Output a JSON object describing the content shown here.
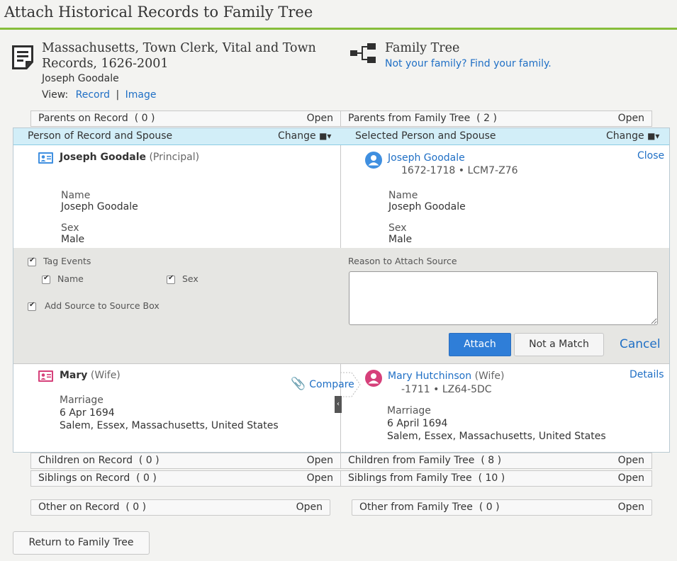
{
  "page": {
    "title": "Attach Historical Records to Family Tree"
  },
  "record": {
    "collection_title_line1": "Massachusetts, Town Clerk, Vital and Town",
    "collection_title_line2": "Records, 1626-2001",
    "person": "Joseph Goodale",
    "view_label": "View:",
    "view_record": "Record",
    "view_sep": "|",
    "view_image": "Image"
  },
  "tree": {
    "title": "Family Tree",
    "link": "Not your family? Find your family."
  },
  "bars": {
    "parents_record": {
      "label": "Parents on Record",
      "count": "( 0 )",
      "action": "Open"
    },
    "parents_tree": {
      "label": "Parents from Family Tree",
      "count": "( 2 )",
      "action": "Open"
    },
    "children_record": {
      "label": "Children on Record",
      "count": "( 0 )",
      "action": "Open"
    },
    "children_tree": {
      "label": "Children from Family Tree",
      "count": "( 8 )",
      "action": "Open"
    },
    "siblings_record": {
      "label": "Siblings on Record",
      "count": "( 0 )",
      "action": "Open"
    },
    "siblings_tree": {
      "label": "Siblings from Family Tree",
      "count": "( 10 )",
      "action": "Open"
    },
    "other_record": {
      "label": "Other on Record",
      "count": "( 0 )",
      "action": "Open"
    },
    "other_tree": {
      "label": "Other from Family Tree",
      "count": "( 0 )",
      "action": "Open"
    }
  },
  "panel": {
    "left_header": "Person of Record and Spouse",
    "right_header": "Selected Person and Spouse",
    "change_label": "Change",
    "close_label": "Close",
    "details_label": "Details",
    "compare_label": "Compare"
  },
  "principal_record": {
    "name": "Joseph Goodale",
    "role": "(Principal)",
    "fields": [
      {
        "label": "Name",
        "value": "Joseph Goodale"
      },
      {
        "label": "Sex",
        "value": "Male"
      }
    ]
  },
  "principal_tree": {
    "name": "Joseph Goodale",
    "lifespan": "1672-1718 • LCM7-Z76",
    "fields": [
      {
        "label": "Name",
        "value": "Joseph Goodale"
      },
      {
        "label": "Sex",
        "value": "Male"
      }
    ]
  },
  "options": {
    "tag_events": "Tag Events",
    "name": "Name",
    "sex": "Sex",
    "add_source": "Add Source to Source Box",
    "reason_label": "Reason to Attach Source",
    "reason_value": ""
  },
  "buttons": {
    "attach": "Attach",
    "not_match": "Not a Match",
    "cancel": "Cancel",
    "return": "Return to Family Tree"
  },
  "spouse_record": {
    "name": "Mary",
    "role": "(Wife)",
    "event_label": "Marriage",
    "event_date": "6 Apr 1694",
    "event_place": "Salem, Essex, Massachusetts, United States"
  },
  "spouse_tree": {
    "name": "Mary Hutchinson",
    "role": "(Wife)",
    "lifespan": "-1711 • LZ64-5DC",
    "event_label": "Marriage",
    "event_date": "6 April 1694",
    "event_place": "Salem, Essex, Massachusetts, United States"
  },
  "colors": {
    "accent_green": "#86bd3b",
    "link_blue": "#1f6fc5",
    "header_blue": "#d2eef8",
    "male_blue": "#3f8fe0",
    "female_pink": "#d6407a",
    "attach_button": "#2f7ed8"
  }
}
